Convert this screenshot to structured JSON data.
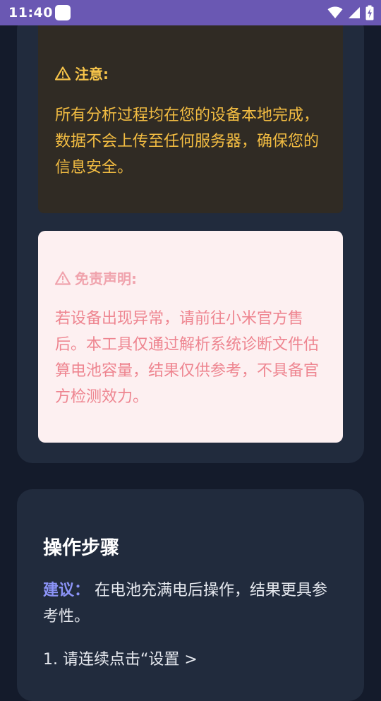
{
  "status_bar": {
    "time": "11:40",
    "icons": [
      "notification-icon",
      "wifi-icon",
      "signal-icon",
      "battery-charging-icon"
    ]
  },
  "notice": {
    "title": "注意:",
    "text": "所有分析过程均在您的设备本地完成，数据不会上传至任何服务器，确保您的信息安全。",
    "icon": "warning-icon"
  },
  "disclaimer": {
    "title": "免责声明:",
    "text": "若设备出现异常，请前往小米官方售后。本工具仅通过解析系统诊断文件估算电池容量，结果仅供参考，不具备官方检测效力。",
    "icon": "warning-icon"
  },
  "steps": {
    "title": "操作步骤",
    "suggestion_label": "建议：",
    "suggestion_text": "在电池充满电后操作，结果更具参考性。",
    "step_1": "1. 请连续点击“设置 >"
  },
  "colors": {
    "status_bar": "#6a58b3",
    "page_bg": "#141b2b",
    "card_bg": "#212b3d",
    "notice_bg": "#302b24",
    "notice_text": "#f2bc42",
    "disclaimer_bg": "#fdf0f1",
    "disclaimer_text": "#ee8590",
    "accent": "#8b93f6"
  }
}
